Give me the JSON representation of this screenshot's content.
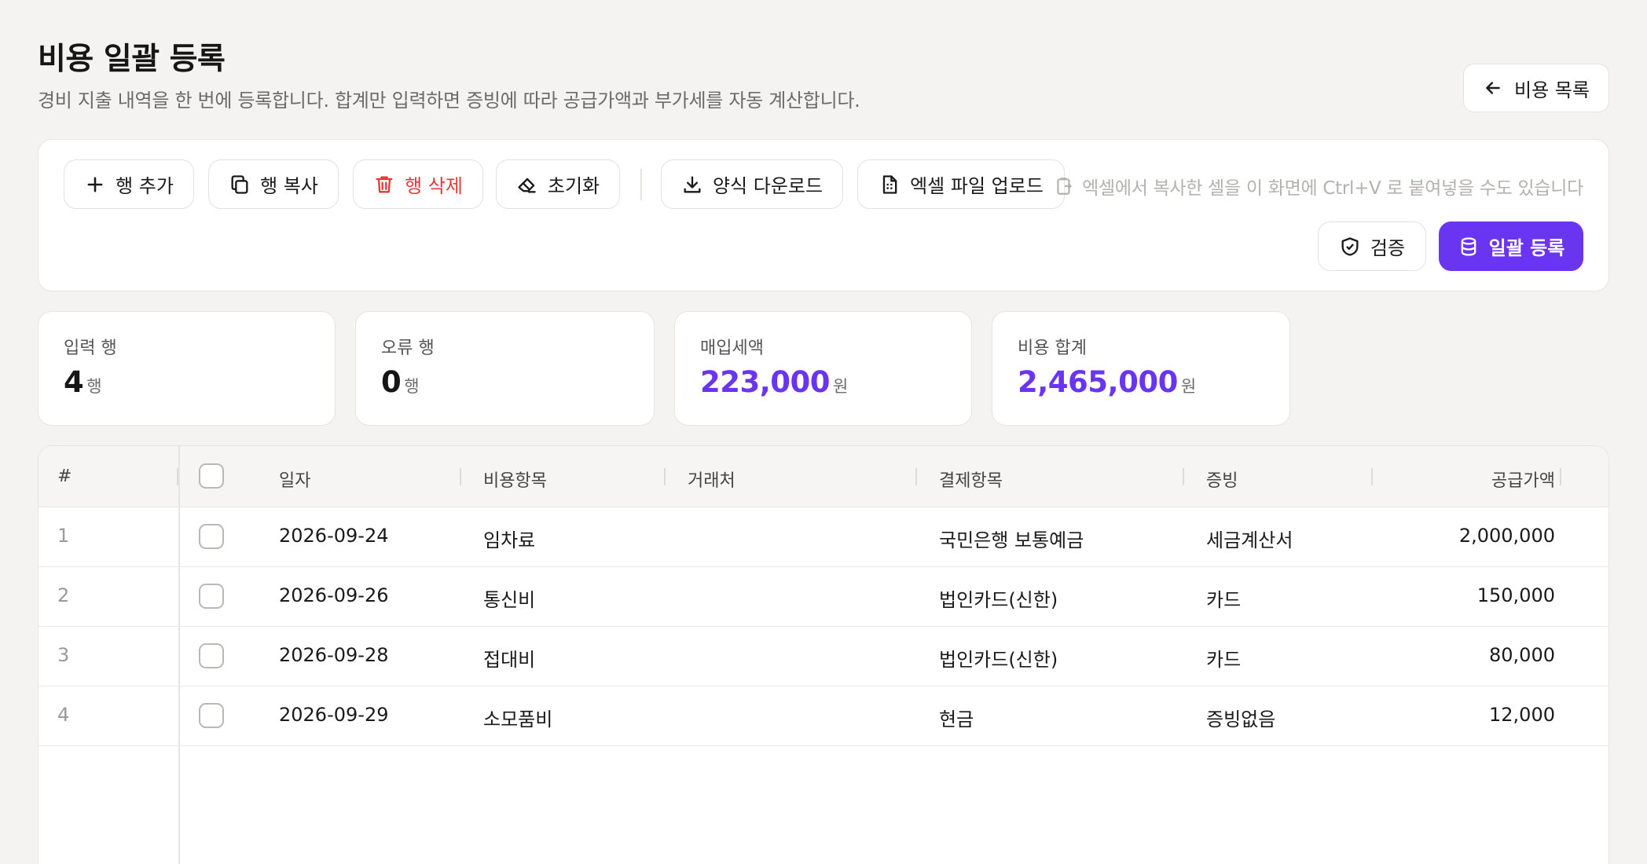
{
  "header": {
    "title": "비용 일괄 등록",
    "subtitle": "경비 지출 내역을 한 번에 등록합니다. 합계만 입력하면 증빙에 따라 공급가액과 부가세를 자동 계산합니다.",
    "back_label": "비용 목록"
  },
  "toolbar": {
    "add_row": "행 추가",
    "copy_row": "행 복사",
    "delete_row": "행 삭제",
    "reset": "초기화",
    "download_template": "양식 다운로드",
    "upload_excel": "엑셀 파일 업로드",
    "paste_hint": "엑셀에서 복사한 셀을 이 화면에 Ctrl+V 로 붙여넣을 수도 있습니다",
    "validate": "검증",
    "submit": "일괄 등록"
  },
  "stats": [
    {
      "label": "입력 행",
      "value": "4",
      "unit": "행"
    },
    {
      "label": "오류 행",
      "value": "0",
      "unit": "행"
    },
    {
      "label": "매입세액",
      "value": "223,000",
      "unit": "원"
    },
    {
      "label": "비용 합계",
      "value": "2,465,000",
      "unit": "원"
    }
  ],
  "table": {
    "columns": [
      "#",
      "일자",
      "비용항목",
      "거래처",
      "결제항목",
      "증빙",
      "공급가액"
    ],
    "rows": [
      {
        "index": "1",
        "date": "2026-09-24",
        "category": "임차료",
        "vendor": "",
        "payment": "국민은행 보통예금",
        "evidence": "세금계산서",
        "supply": "2,000,000"
      },
      {
        "index": "2",
        "date": "2026-09-26",
        "category": "통신비",
        "vendor": "",
        "payment": "법인카드(신한)",
        "evidence": "카드",
        "supply": "150,000"
      },
      {
        "index": "3",
        "date": "2026-09-28",
        "category": "접대비",
        "vendor": "",
        "payment": "법인카드(신한)",
        "evidence": "카드",
        "supply": "80,000"
      },
      {
        "index": "4",
        "date": "2026-09-29",
        "category": "소모품비",
        "vendor": "",
        "payment": "현금",
        "evidence": "증빙없음",
        "supply": "12,000"
      }
    ]
  },
  "colors": {
    "accent": "#6a35f0",
    "danger": "#e03a3a",
    "background": "#f4f3f1"
  }
}
